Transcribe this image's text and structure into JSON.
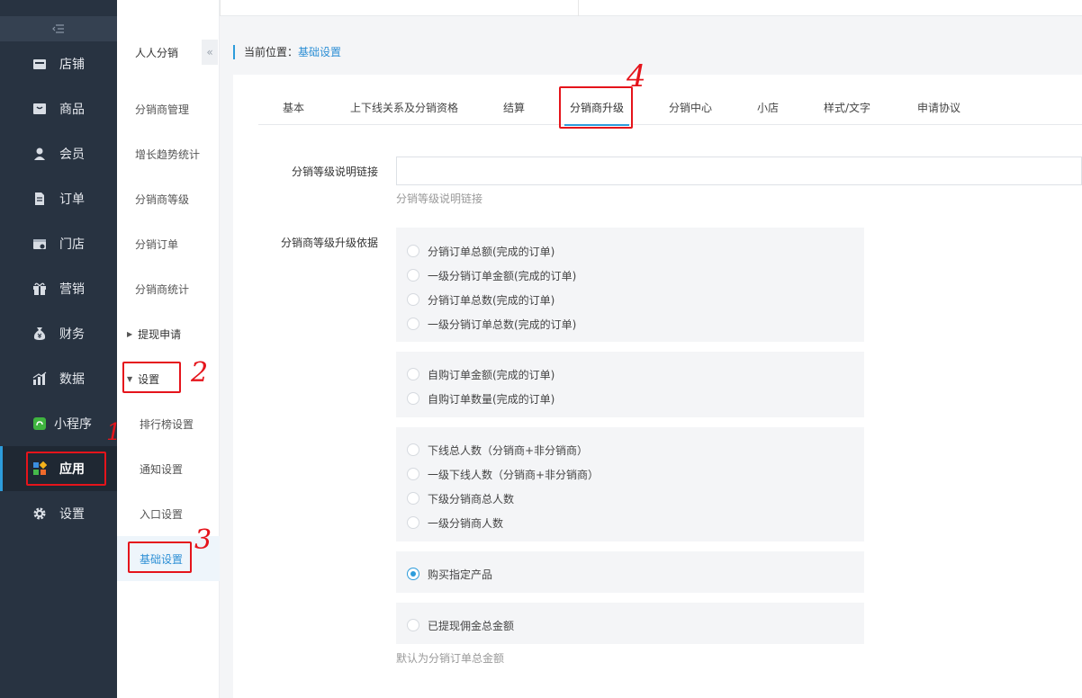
{
  "sidebar": {
    "items": [
      {
        "label": "店铺",
        "icon": "store-icon"
      },
      {
        "label": "商品",
        "icon": "product-icon"
      },
      {
        "label": "会员",
        "icon": "member-icon"
      },
      {
        "label": "订单",
        "icon": "order-icon"
      },
      {
        "label": "门店",
        "icon": "shop-icon"
      },
      {
        "label": "营销",
        "icon": "gift-icon"
      },
      {
        "label": "财务",
        "icon": "money-bag-icon"
      },
      {
        "label": "数据",
        "icon": "chart-icon"
      },
      {
        "label": "小程序",
        "icon": "mini-program-icon"
      },
      {
        "label": "应用",
        "icon": "apps-icon"
      },
      {
        "label": "设置",
        "icon": "gear-icon"
      }
    ]
  },
  "submenu": {
    "title": "人人分销",
    "items": [
      {
        "label": "分销商管理"
      },
      {
        "label": "增长趋势统计"
      },
      {
        "label": "分销商等级"
      },
      {
        "label": "分销订单"
      },
      {
        "label": "分销商统计"
      },
      {
        "label": "提现申请"
      },
      {
        "label": "设置"
      },
      {
        "label": "排行榜设置"
      },
      {
        "label": "通知设置"
      },
      {
        "label": "入口设置"
      },
      {
        "label": "基础设置"
      }
    ]
  },
  "breadcrumb": {
    "prefix": "当前位置：",
    "current": "基础设置"
  },
  "tabs": [
    {
      "label": "基本"
    },
    {
      "label": "上下线关系及分销资格"
    },
    {
      "label": "结算"
    },
    {
      "label": "分销商升级"
    },
    {
      "label": "分销中心"
    },
    {
      "label": "小店"
    },
    {
      "label": "样式/文字"
    },
    {
      "label": "申请协议"
    }
  ],
  "form": {
    "link_label": "分销等级说明链接",
    "link_value": "",
    "link_help": "分销等级说明链接",
    "basis_label": "分销商等级升级依据",
    "groups": [
      {
        "options": [
          {
            "label": "分销订单总额(完成的订单)",
            "checked": false
          },
          {
            "label": "一级分销订单金额(完成的订单)",
            "checked": false
          },
          {
            "label": "分销订单总数(完成的订单)",
            "checked": false
          },
          {
            "label": "一级分销订单总数(完成的订单)",
            "checked": false
          }
        ]
      },
      {
        "options": [
          {
            "label": "自购订单金额(完成的订单)",
            "checked": false
          },
          {
            "label": "自购订单数量(完成的订单)",
            "checked": false
          }
        ]
      },
      {
        "options": [
          {
            "label": "下线总人数（分销商+非分销商）",
            "checked": false
          },
          {
            "label": "一级下线人数（分销商+非分销商）",
            "checked": false
          },
          {
            "label": "下级分销商总人数",
            "checked": false
          },
          {
            "label": "一级分销商人数",
            "checked": false
          }
        ]
      },
      {
        "options": [
          {
            "label": "购买指定产品",
            "checked": true
          }
        ]
      },
      {
        "options": [
          {
            "label": "已提现佣金总金额",
            "checked": false
          }
        ]
      }
    ],
    "basis_help": "默认为分销订单总金额"
  },
  "annotations": {
    "n1": "1",
    "n2": "2",
    "n3": "3",
    "n4": "4"
  },
  "colors": {
    "sidebar_bg": "#283341",
    "accent": "#2d9cdb",
    "annotation": "#e5141b"
  }
}
